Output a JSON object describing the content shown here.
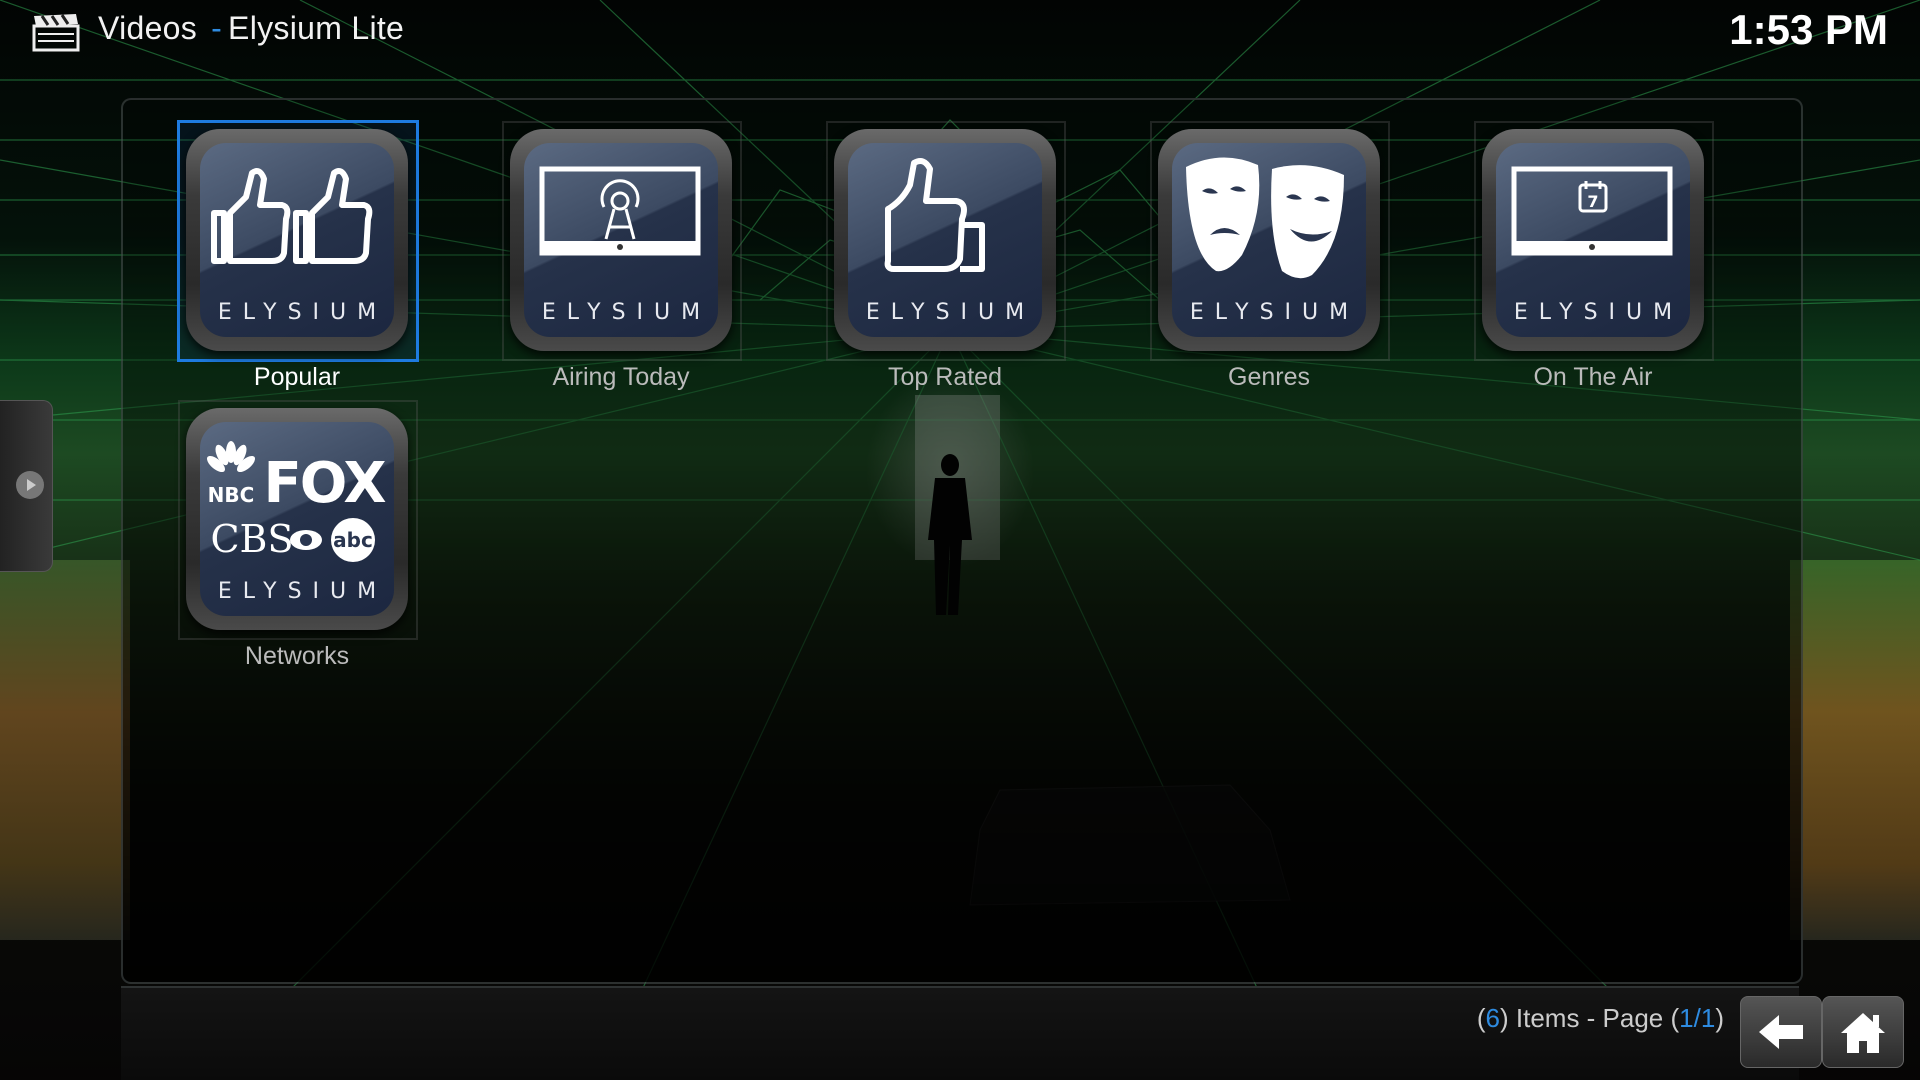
{
  "header": {
    "section": "Videos",
    "separator": "-",
    "skin_name": "Elysium Lite",
    "clock": "1:53 PM",
    "icon": "clapperboard-icon"
  },
  "tiles": [
    {
      "label": "Popular",
      "brand": "ELYSIUM",
      "icon": "two-thumbs-up-icon",
      "focused": true
    },
    {
      "label": "Airing Today",
      "brand": "ELYSIUM",
      "icon": "tv-broadcast-icon",
      "focused": false
    },
    {
      "label": "Top Rated",
      "brand": "ELYSIUM",
      "icon": "thumbs-up-icon",
      "focused": false
    },
    {
      "label": "Genres",
      "brand": "ELYSIUM",
      "icon": "theater-masks-icon",
      "focused": false
    },
    {
      "label": "On The Air",
      "brand": "ELYSIUM",
      "icon": "tv-calendar-icon",
      "focused": false
    },
    {
      "label": "Networks",
      "brand": "ELYSIUM",
      "icon": "network-logos-icon",
      "focused": false,
      "logos": {
        "nbc": "NBC",
        "fox": "FOX",
        "cbs": "CBS",
        "abc": "abc"
      }
    }
  ],
  "calendar_day": "7",
  "footer": {
    "items_count": "6",
    "items_text": "Items - Page",
    "page": "1/1",
    "back_icon": "back-arrow-icon",
    "home_icon": "home-icon"
  },
  "colors": {
    "accent": "#1e7be0",
    "highlight_text": "#2e8be0"
  }
}
